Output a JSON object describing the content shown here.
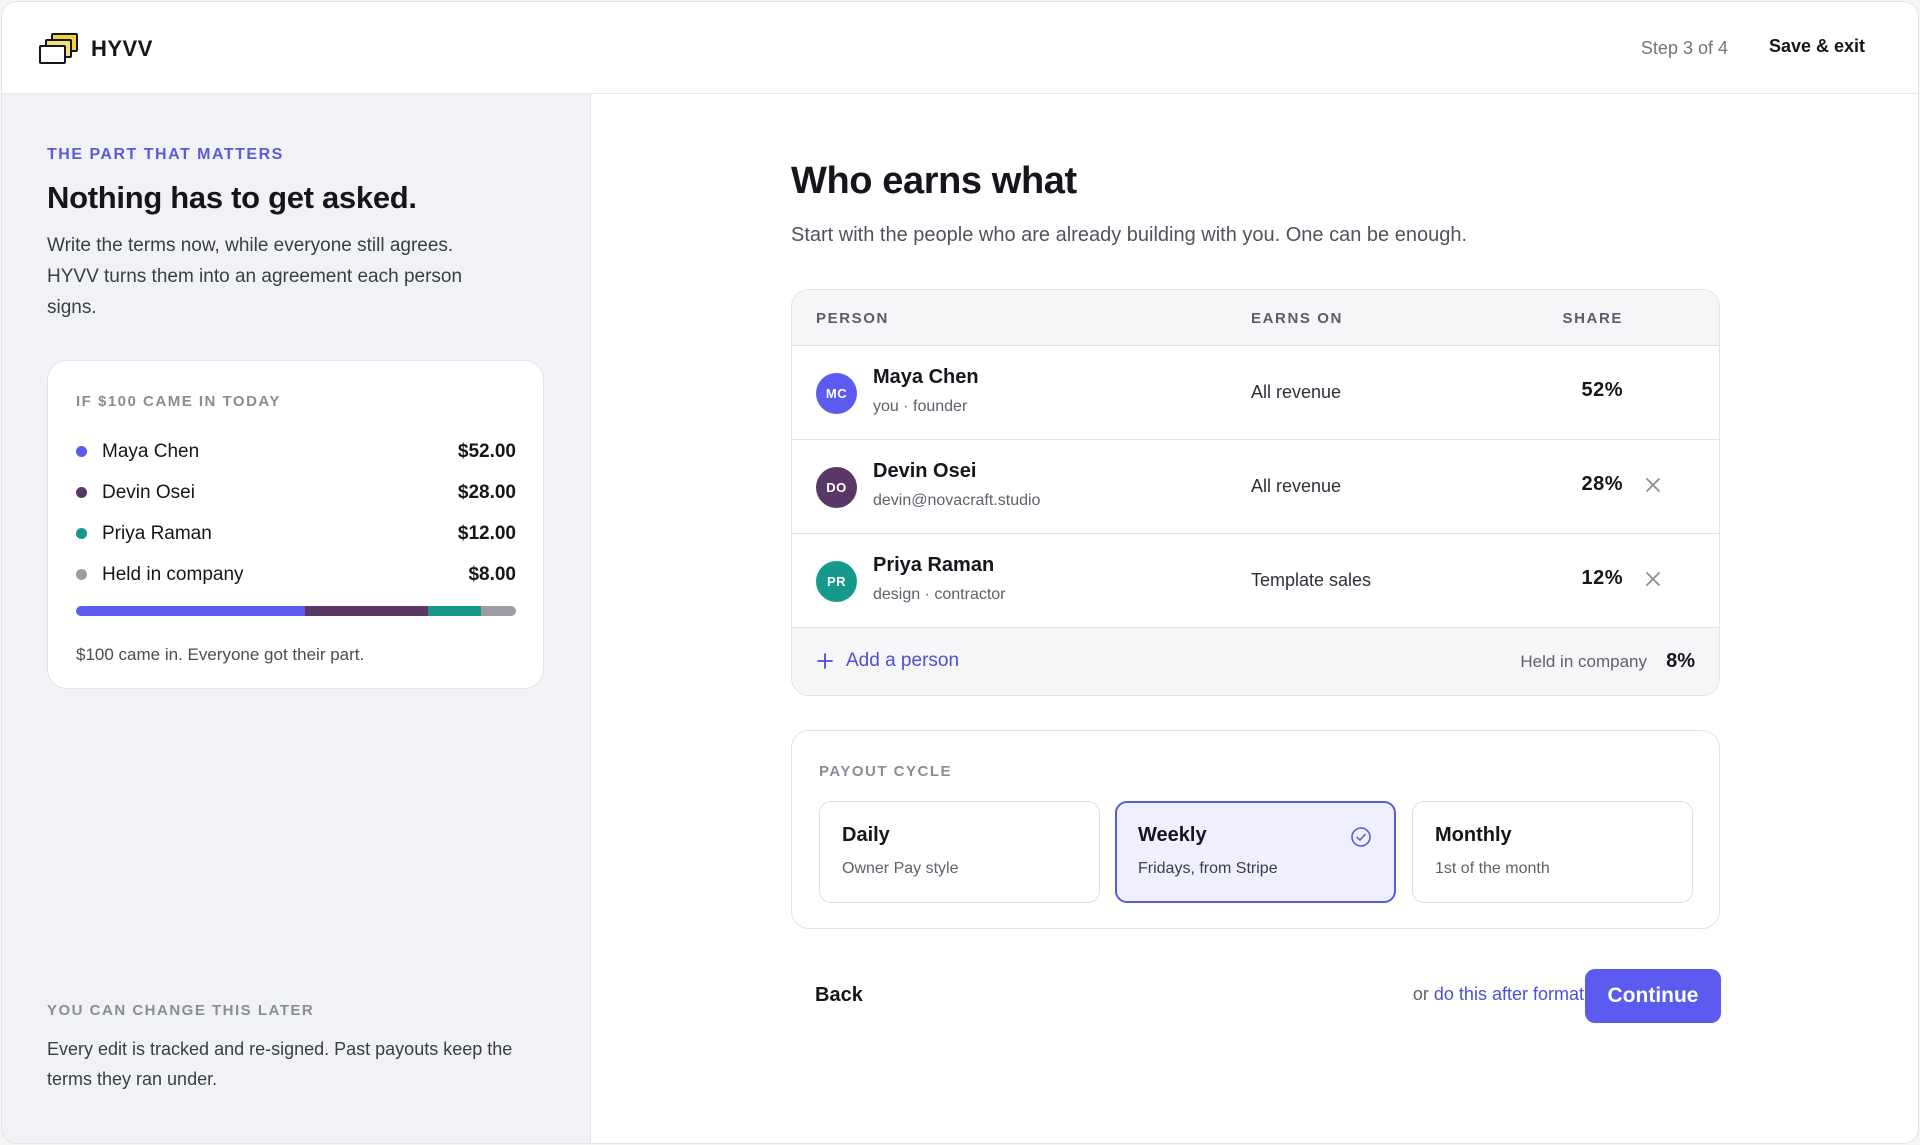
{
  "header": {
    "brand": "HYVV",
    "step": "Step 3 of 4",
    "save_exit": "Save & exit"
  },
  "sidebar": {
    "eyebrow": "THE PART THAT MATTERS",
    "title": "Nothing has to get asked.",
    "body": "Write the terms now, while everyone still agrees. HYVV turns them into an agreement each person signs.",
    "simulation": {
      "eyebrow": "IF $100 CAME IN TODAY",
      "rows": [
        {
          "name": "Maya Chen",
          "amount": "$52.00",
          "share": 52,
          "color": "#5b5bf0"
        },
        {
          "name": "Devin Osei",
          "amount": "$28.00",
          "share": 28,
          "color": "#5a3766"
        },
        {
          "name": "Priya Raman",
          "amount": "$12.00",
          "share": 12,
          "color": "#16998a"
        },
        {
          "name": "Held in company",
          "amount": "$8.00",
          "share": 8,
          "color": "#9a9ca6"
        }
      ],
      "footer": "$100 came in. Everyone got their part."
    },
    "note_eyebrow": "YOU CAN CHANGE THIS LATER",
    "note_body": "Every edit is tracked and re-signed. Past payouts keep the terms they ran under."
  },
  "main": {
    "title": "Who earns what",
    "subtitle": "Start with the people who are already building with you. One can be enough.",
    "table": {
      "headers": {
        "person": "PERSON",
        "earns_on": "EARNS ON",
        "share": "SHARE"
      },
      "rows": [
        {
          "initials": "MC",
          "name": "Maya Chen",
          "meta": "you · founder",
          "earns_on": "All revenue",
          "share": "52%",
          "color": "#5b5bf0",
          "removable": false
        },
        {
          "initials": "DO",
          "name": "Devin Osei",
          "meta": "devin@novacraft.studio",
          "earns_on": "All revenue",
          "share": "28%",
          "color": "#5a3766",
          "removable": true
        },
        {
          "initials": "PR",
          "name": "Priya Raman",
          "meta": "design · contractor",
          "earns_on": "Template sales",
          "share": "12%",
          "color": "#16998a",
          "removable": true
        }
      ],
      "add_person": "Add a person",
      "held_label": "Held in company",
      "held_value": "8%"
    },
    "payout": {
      "eyebrow": "PAYOUT CYCLE",
      "options": [
        {
          "title": "Daily",
          "sub": "Owner Pay style",
          "selected": false
        },
        {
          "title": "Weekly",
          "sub": "Fridays, from Stripe",
          "selected": true
        },
        {
          "title": "Monthly",
          "sub": "1st of the month",
          "selected": false
        }
      ]
    },
    "back": "Back",
    "defer_prefix": "or",
    "defer_link": "do this after formation",
    "continue": "Continue"
  },
  "colors": {
    "accent": "#5b5bf0",
    "accent_text": "#4e4ed8",
    "eyebrow": "#5b5bd6"
  }
}
